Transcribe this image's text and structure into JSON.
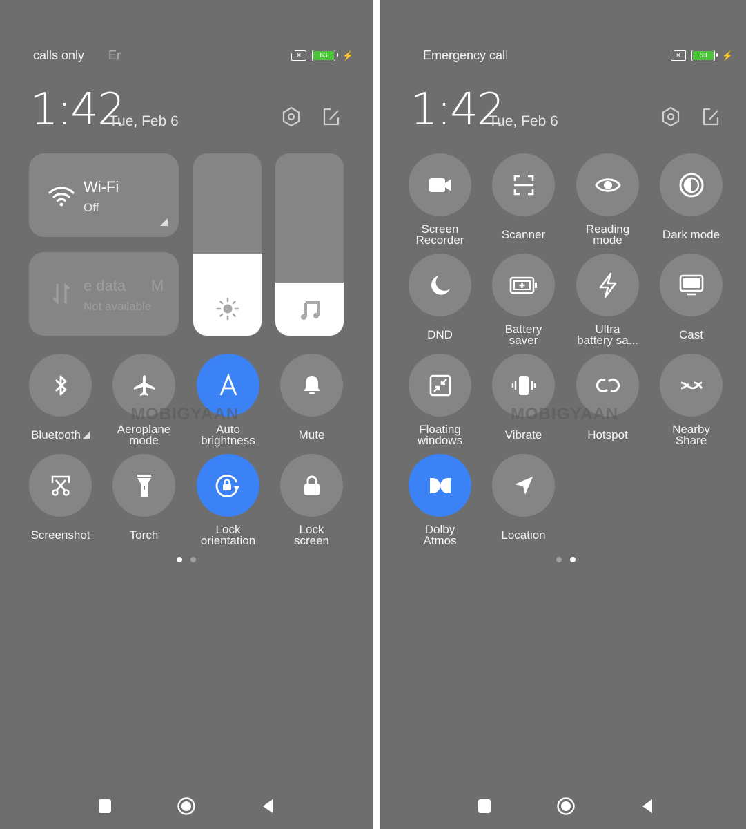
{
  "left": {
    "status_text": "calls only",
    "status_text_fade": "Er",
    "battery_level": "63",
    "time": "1:42",
    "date": "Tue, Feb 6",
    "wifi_tile": {
      "title": "Wi-Fi",
      "subtitle": "Off",
      "icon": "wifi-icon"
    },
    "data_tile": {
      "title": "e data",
      "title_fade": "M",
      "subtitle": "Not available",
      "icon": "mobile-data-icon"
    },
    "brightness_level": 0.45,
    "volume_level": 0.29,
    "toggles": [
      {
        "label": "Bluetooth",
        "icon": "bluetooth-icon",
        "on": false
      },
      {
        "label": "Aeroplane\nmode",
        "icon": "airplane-icon",
        "on": false
      },
      {
        "label": "Auto\nbrightness",
        "icon": "auto-brightness-icon",
        "on": true
      },
      {
        "label": "Mute",
        "icon": "bell-icon",
        "on": false
      },
      {
        "label": "Screenshot",
        "icon": "screenshot-icon",
        "on": false
      },
      {
        "label": "Torch",
        "icon": "torch-icon",
        "on": false
      },
      {
        "label": "Lock\norientation",
        "icon": "lock-rotation-icon",
        "on": true
      },
      {
        "label": "Lock\nscreen",
        "icon": "lock-icon",
        "on": false
      }
    ],
    "page_indicator": {
      "current": 1,
      "total": 2
    }
  },
  "right": {
    "status_text": "Emergency cal",
    "status_text_fade": "l",
    "battery_level": "63",
    "time": "1:42",
    "date": "Tue, Feb 6",
    "toggles": [
      {
        "label": "Screen\nRecorder",
        "icon": "video-camera-icon",
        "on": false
      },
      {
        "label": "Scanner",
        "icon": "scanner-icon",
        "on": false
      },
      {
        "label": "Reading\nmode",
        "icon": "eye-icon",
        "on": false
      },
      {
        "label": "Dark mode",
        "icon": "dark-mode-icon",
        "on": false
      },
      {
        "label": "DND",
        "icon": "moon-icon",
        "on": false
      },
      {
        "label": "Battery\nsaver",
        "icon": "battery-saver-icon",
        "on": false
      },
      {
        "label": "Ultra\nbattery sa...",
        "icon": "lightning-icon",
        "on": false
      },
      {
        "label": "Cast",
        "icon": "monitor-icon",
        "on": false
      },
      {
        "label": "Floating\nwindows",
        "icon": "floating-window-icon",
        "on": false
      },
      {
        "label": "Vibrate",
        "icon": "vibrate-icon",
        "on": false
      },
      {
        "label": "Hotspot",
        "icon": "hotspot-icon",
        "on": false
      },
      {
        "label": "Nearby\nShare",
        "icon": "nearby-share-icon",
        "on": false
      },
      {
        "label": "Dolby\nAtmos",
        "icon": "dolby-icon",
        "on": true
      },
      {
        "label": "Location",
        "icon": "location-icon",
        "on": false
      }
    ],
    "page_indicator": {
      "current": 2,
      "total": 2
    }
  },
  "watermark": "MOBIGYAAN",
  "colors": {
    "background": "#6e6e6e",
    "tile": "#858585",
    "accent": "#3b82f6",
    "battery": "#4cc43a"
  }
}
